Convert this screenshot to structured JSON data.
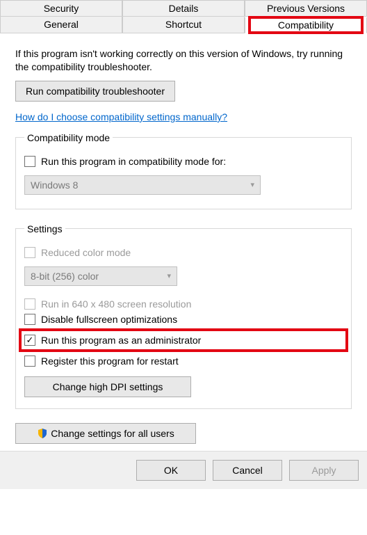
{
  "tabs": {
    "row1": [
      "Security",
      "Details",
      "Previous Versions"
    ],
    "row2": [
      "General",
      "Shortcut",
      "Compatibility"
    ],
    "active": "Compatibility"
  },
  "intro": "If this program isn't working correctly on this version of Windows, try running the compatibility troubleshooter.",
  "buttons": {
    "run_troubleshooter": "Run compatibility troubleshooter",
    "change_dpi": "Change high DPI settings",
    "change_all_users": "Change settings for all users",
    "ok": "OK",
    "cancel": "Cancel",
    "apply": "Apply"
  },
  "link": "How do I choose compatibility settings manually?",
  "groups": {
    "compat_mode": {
      "legend": "Compatibility mode",
      "checkbox": "Run this program in compatibility mode for:",
      "select_value": "Windows 8"
    },
    "settings": {
      "legend": "Settings",
      "reduced_color": "Reduced color mode",
      "color_select": "8-bit (256) color",
      "run_640": "Run in 640 x 480 screen resolution",
      "disable_fullscreen": "Disable fullscreen optimizations",
      "run_admin": "Run this program as an administrator",
      "register_restart": "Register this program for restart"
    }
  }
}
